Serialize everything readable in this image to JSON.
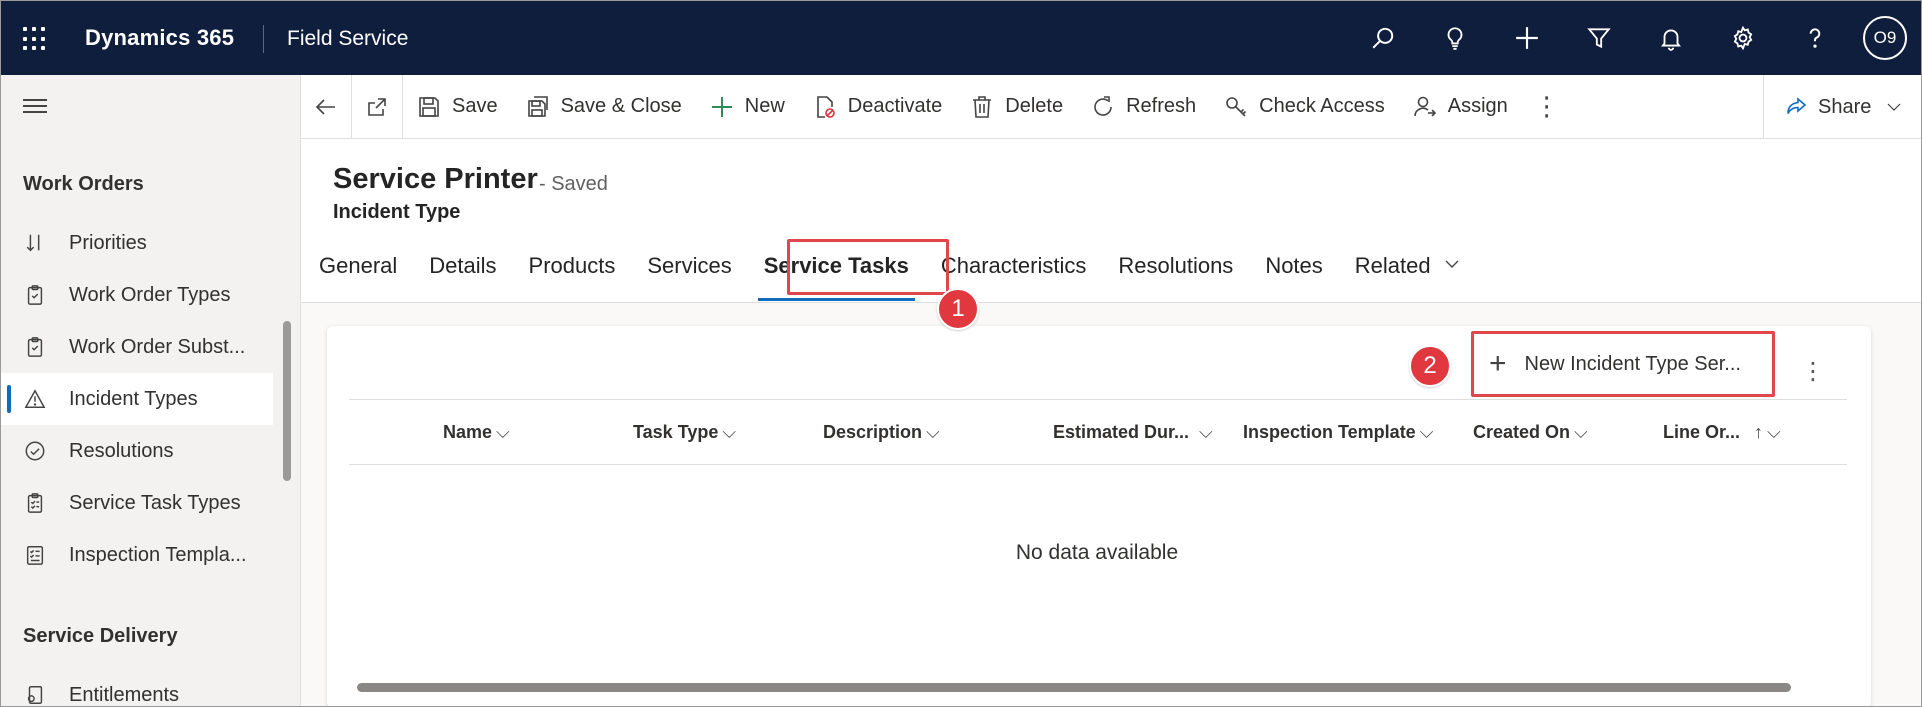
{
  "topbar": {
    "brand": "Dynamics 365",
    "app_name": "Field Service",
    "icons": [
      "search-icon",
      "lightbulb-icon",
      "plus-icon",
      "filter-icon",
      "bell-icon",
      "gear-icon",
      "help-icon"
    ],
    "avatar_initials": "O9",
    "background": "#0f1e3c"
  },
  "sidenav": {
    "group1": "Work Orders",
    "items": [
      {
        "label": "Priorities",
        "icon": "sort-icon"
      },
      {
        "label": "Work Order Types",
        "icon": "clipboard-icon"
      },
      {
        "label": "Work Order Subst...",
        "icon": "clipboard-icon"
      },
      {
        "label": "Incident Types",
        "icon": "warning-icon",
        "active": true
      },
      {
        "label": "Resolutions",
        "icon": "check-circle-icon"
      },
      {
        "label": "Service Task Types",
        "icon": "tasks-icon"
      },
      {
        "label": "Inspection Templa...",
        "icon": "checklist-icon"
      }
    ],
    "group2": "Service Delivery",
    "items2": [
      {
        "label": "Entitlements",
        "icon": "entitlement-icon"
      }
    ]
  },
  "commandbar": {
    "save": "Save",
    "save_close": "Save & Close",
    "new": "New",
    "deactivate": "Deactivate",
    "delete": "Delete",
    "refresh": "Refresh",
    "check_access": "Check Access",
    "assign": "Assign",
    "share": "Share"
  },
  "form": {
    "title": "Service Printer",
    "status": "- Saved",
    "entity": "Incident Type",
    "tabs": [
      "General",
      "Details",
      "Products",
      "Services",
      "Service Tasks",
      "Characteristics",
      "Resolutions",
      "Notes",
      "Related"
    ],
    "active_tab": "Service Tasks"
  },
  "annotations": {
    "badge1": "1",
    "badge2": "2",
    "color": "#e0474c"
  },
  "subgrid": {
    "new_button": "New Incident Type Ser...",
    "columns": [
      "Name",
      "Task Type",
      "Description",
      "Estimated Dur...",
      "Inspection Template",
      "Created On",
      "Line Or..."
    ],
    "empty_text": "No data available"
  }
}
